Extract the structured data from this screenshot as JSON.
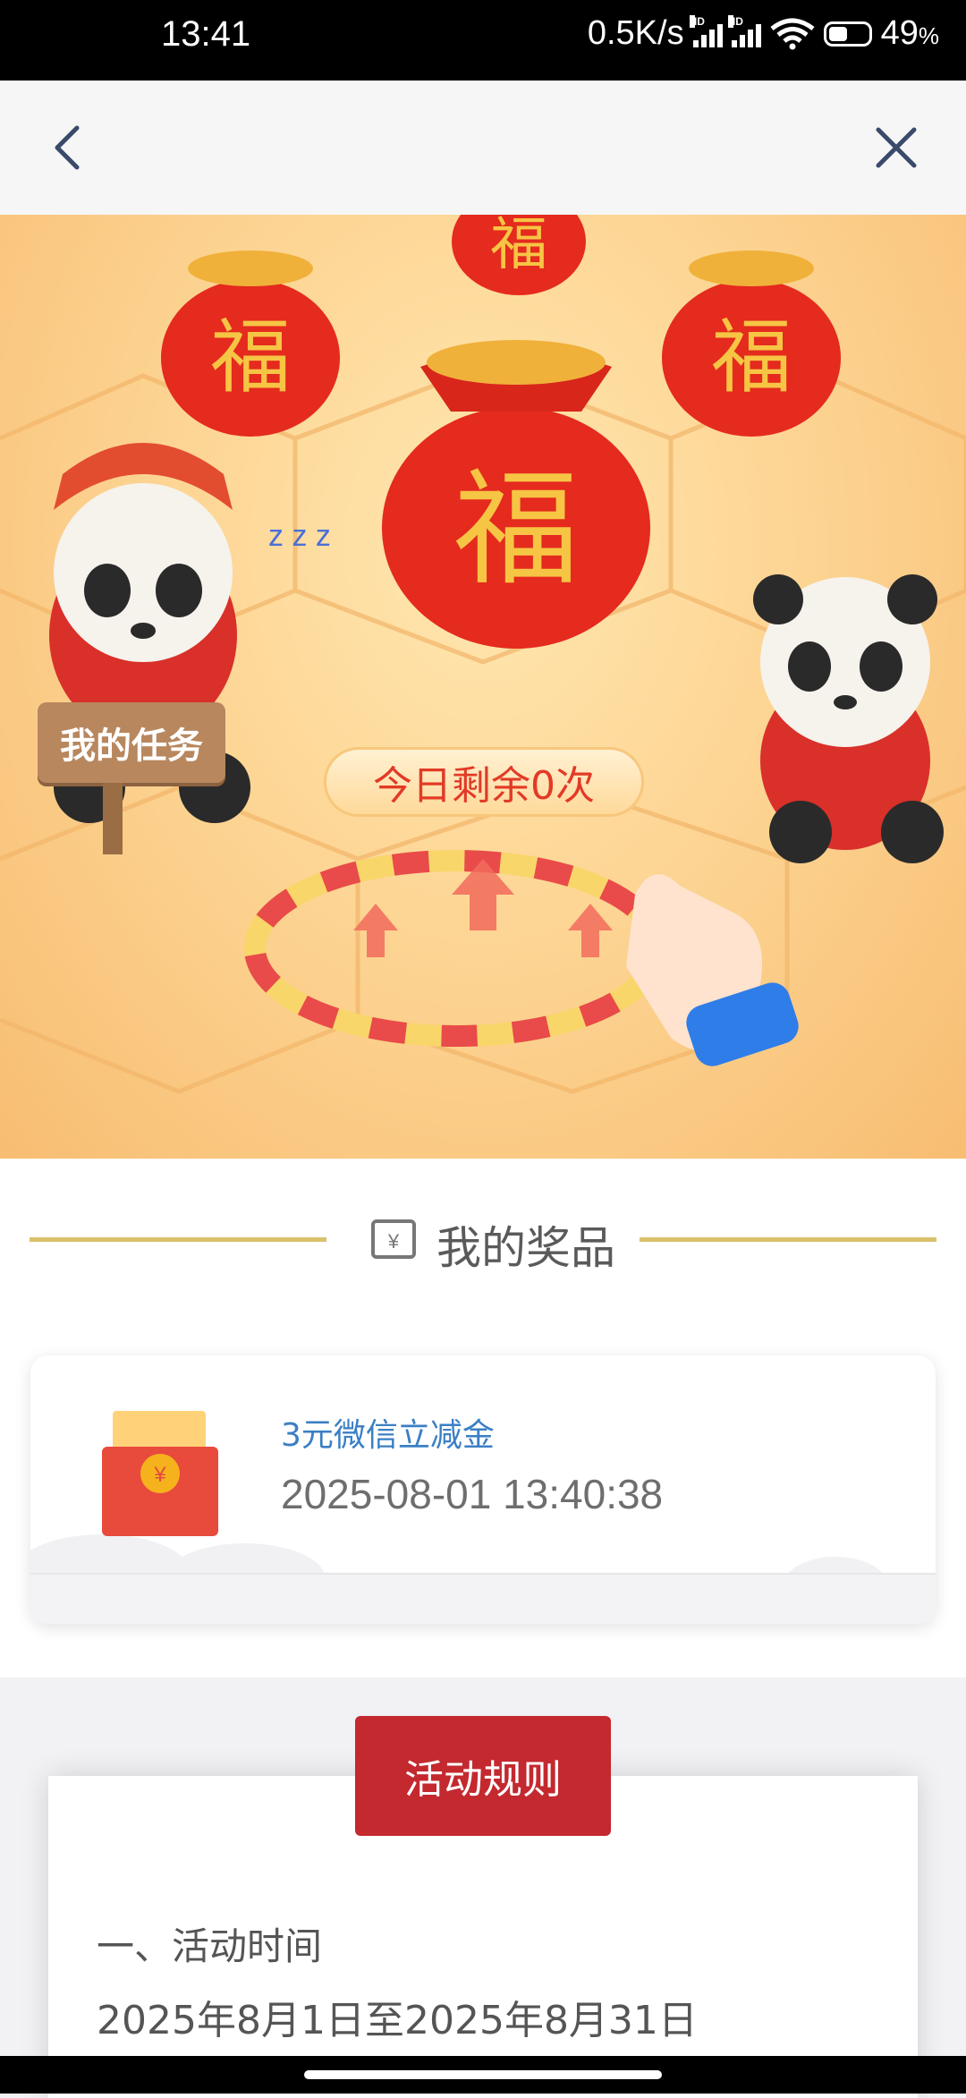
{
  "status_bar": {
    "time": "13:41",
    "network_speed": "0.5K/s",
    "battery": "49",
    "battery_unit": "%",
    "battery_level": 0.49,
    "hd_label": "HD",
    "icons": [
      "signal-hd-icon",
      "signal-hd-icon",
      "wifi-6-icon",
      "battery-icon"
    ]
  },
  "nav": {
    "back_icon": "chevron-left-icon",
    "close_icon": "close-icon"
  },
  "game": {
    "task_button": "我的任务",
    "remaining_label": "今日剩余0次",
    "bag_char": "福",
    "colors": {
      "bag": "#e52a1e",
      "gold": "#f6c544",
      "ring_red": "#e94a4a",
      "ring_yellow": "#f8d66a"
    }
  },
  "prizes": {
    "title": "我的奖品",
    "items": [
      {
        "name": "3元微信立减金",
        "time": "2025-08-01 13:40:38",
        "icon": "red-packet-icon",
        "coin_symbol": "¥"
      }
    ]
  },
  "rules": {
    "button_label": "活动规则",
    "section_heading": "一、活动时间",
    "section_text": "2025年8月1日至2025年8月31日"
  },
  "colors": {
    "accent_red": "#c3292f",
    "gold_line": "#d8c16a",
    "prize_name_blue": "#3b7fc4"
  }
}
